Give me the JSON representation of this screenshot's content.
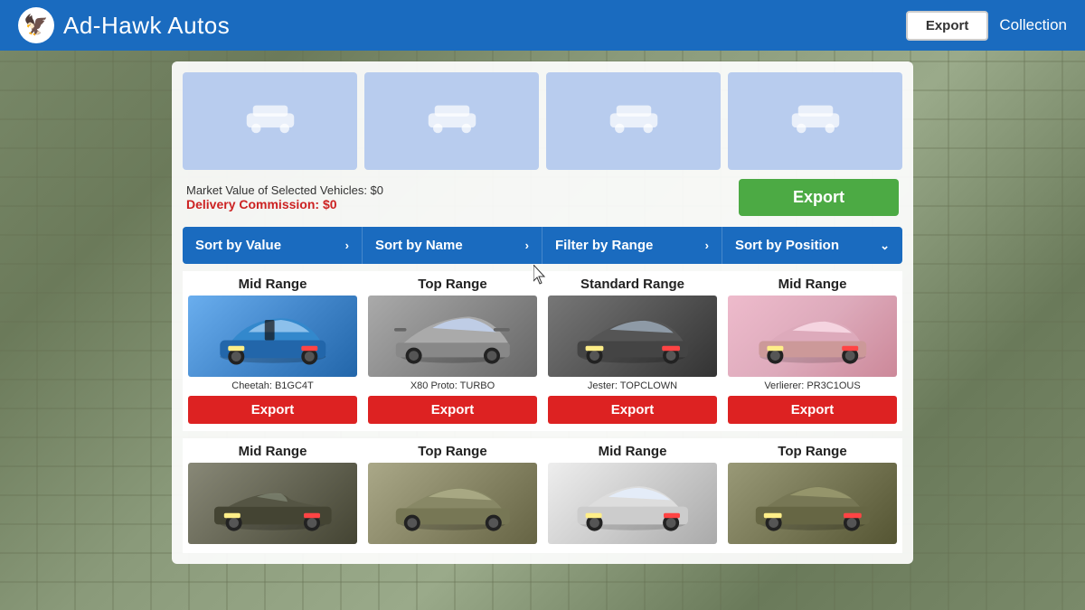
{
  "header": {
    "logo_symbol": "🦅",
    "title_bold": "Ad-Hawk",
    "title_normal": " Autos",
    "export_label": "Export",
    "collection_label": "Collection"
  },
  "info": {
    "market_value_label": "Market Value of Selected Vehicles: $0",
    "delivery_commission_label": "Delivery Commission: $0",
    "export_button_label": "Export"
  },
  "sort_bar": {
    "sort_by_value": "Sort by Value",
    "sort_by_name": "Sort by Name",
    "filter_by_range": "Filter by Range",
    "sort_by_position": "Sort by Position",
    "arrow_right": "›",
    "arrow_down": "⌄"
  },
  "vehicles": [
    {
      "range": "Mid Range",
      "name": "Cheetah: B1GC4T",
      "export_label": "Export",
      "color_class": "car-svg-blue",
      "bottom_range": "Mid Range"
    },
    {
      "range": "Top Range",
      "name": "X80 Proto: TURBO",
      "export_label": "Export",
      "color_class": "car-svg-silver",
      "bottom_range": "Top Range"
    },
    {
      "range": "Standard Range",
      "name": "Jester: TOPCLOWN",
      "export_label": "Export",
      "color_class": "car-svg-silver",
      "bottom_range": "Mid Range"
    },
    {
      "range": "Mid Range",
      "name": "Verlierer: PR3C1OUS",
      "export_label": "Export",
      "color_class": "car-svg-pink",
      "bottom_range": "Top Range"
    }
  ],
  "vehicles_row2": [
    {
      "range": "Mid Range",
      "color_class": "car-svg-dark"
    },
    {
      "range": "Top Range",
      "color_class": "car-svg-olive"
    },
    {
      "range": "Mid Range",
      "color_class": "car-svg-white"
    },
    {
      "range": "Top Range",
      "color_class": "car-svg-darkgold"
    }
  ],
  "colors": {
    "header_bg": "#1a6bbf",
    "sort_bar_bg": "#1a6bbf",
    "export_green": "#4caa44",
    "export_red": "#dd2222",
    "slot_blue": "#b8ccee"
  }
}
